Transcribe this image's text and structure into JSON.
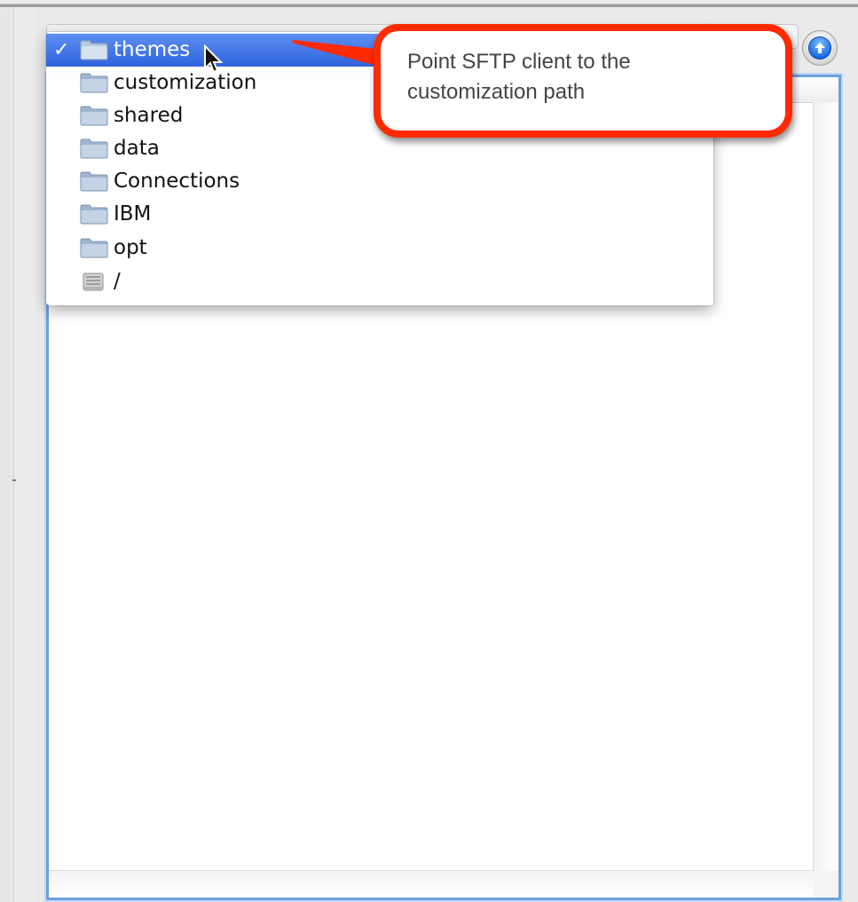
{
  "path_menu": {
    "check_mark": "✓",
    "items": [
      {
        "label": "themes",
        "icon": "folder-icon",
        "selected": true
      },
      {
        "label": "customization",
        "icon": "folder-icon",
        "selected": false
      },
      {
        "label": "shared",
        "icon": "folder-icon",
        "selected": false
      },
      {
        "label": "data",
        "icon": "folder-icon",
        "selected": false
      },
      {
        "label": "Connections",
        "icon": "folder-icon",
        "selected": false
      },
      {
        "label": "IBM",
        "icon": "folder-icon",
        "selected": false
      },
      {
        "label": "opt",
        "icon": "folder-icon",
        "selected": false
      },
      {
        "label": "/",
        "icon": "hard-drive-icon",
        "selected": false
      }
    ]
  },
  "callout": {
    "text": "Point SFTP client to the customization path",
    "border_color": "#ff2a00"
  },
  "toolbar": {
    "up_button_icon": "arrow-up-icon"
  },
  "colors": {
    "selection": "#3f74e6",
    "list_focus_border": "#6d9fdc"
  }
}
